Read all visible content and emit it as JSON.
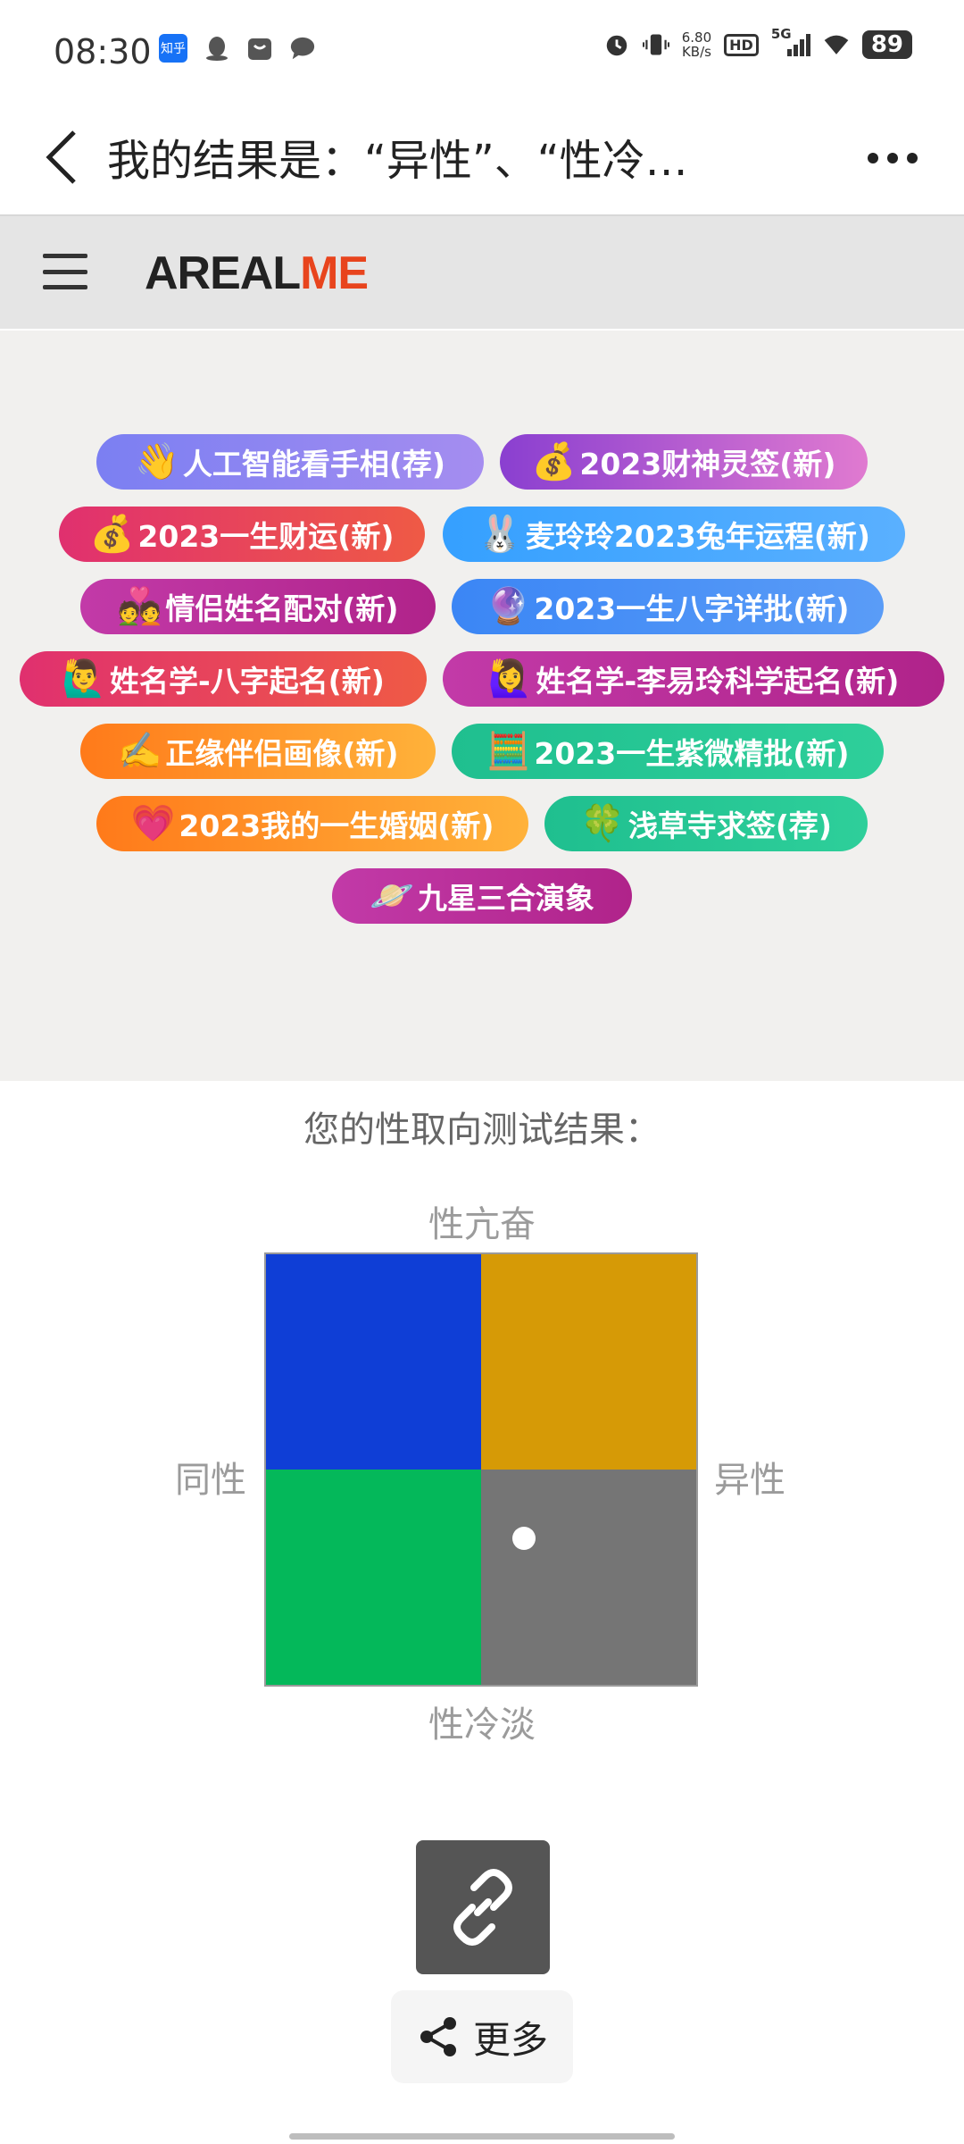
{
  "status_bar": {
    "time": "08:30",
    "zhihu_icon_text": "知乎",
    "speed_value": "6.80",
    "speed_unit": "KB/s",
    "hd": "HD",
    "signal": "5G",
    "battery": "89"
  },
  "header": {
    "title": "我的结果是：“异性”、“性冷…"
  },
  "site": {
    "logo_a": "AREAL",
    "logo_b": "ME"
  },
  "pills": [
    {
      "emoji": "👋",
      "label": "人工智能看手相(荐)",
      "color1": "#7b7ff2",
      "color2": "#a58df0"
    },
    {
      "emoji": "💰",
      "label": "2023财神灵签(新)",
      "color1": "#8a3fd0",
      "color2": "#e07ad0"
    },
    {
      "emoji": "💰",
      "label": "2023一生财运(新)",
      "color1": "#e0306f",
      "color2": "#ef5a45"
    },
    {
      "emoji": "🐰",
      "label": "麦玲玲2023兔年运程(新)",
      "color1": "#35a0ff",
      "color2": "#5ab0ff"
    },
    {
      "emoji": "💑",
      "label": "情侣姓名配对(新)",
      "color1": "#c23aa8",
      "color2": "#b0238a"
    },
    {
      "emoji": "🔮",
      "label": "2023一生八字详批(新)",
      "color1": "#3b86f5",
      "color2": "#5a9cf7"
    },
    {
      "emoji": "🙋‍♂️",
      "label": "姓名学-八字起名(新)",
      "color1": "#e0306f",
      "color2": "#ef5a45"
    },
    {
      "emoji": "🙋‍♀️",
      "label": "姓名学-李易玲科学起名(新)",
      "color1": "#c23aa8",
      "color2": "#b0238a"
    },
    {
      "emoji": "✍️",
      "label": "正缘伴侣画像(新)",
      "color1": "#ff7a1a",
      "color2": "#ffb23a"
    },
    {
      "emoji": "🧮",
      "label": "2023一生紫微精批(新)",
      "color1": "#1fbf8f",
      "color2": "#2ecf9a"
    },
    {
      "emoji": "💗",
      "label": "2023我的一生婚姻(新)",
      "color1": "#ff7a1a",
      "color2": "#ffb23a"
    },
    {
      "emoji": "🍀",
      "label": "浅草寺求签(荐)",
      "color1": "#1fbf8f",
      "color2": "#2ecf9a"
    },
    {
      "emoji": "🪐",
      "label": "九星三合演象",
      "color1": "#c23aa8",
      "color2": "#b0238a"
    }
  ],
  "result": {
    "title": "您的性取向测试结果：",
    "top_label": "性亢奋",
    "bottom_label": "性冷淡",
    "left_label": "同性",
    "right_label": "异性",
    "quadrant_colors": {
      "top_left": "#0f3ed6",
      "top_right": "#d69a06",
      "bottom_left": "#04b85a",
      "bottom_right": "#757575"
    },
    "marker": {
      "orientation": 0.2,
      "drive": -0.32
    }
  },
  "actions": {
    "share_label": "更多"
  }
}
